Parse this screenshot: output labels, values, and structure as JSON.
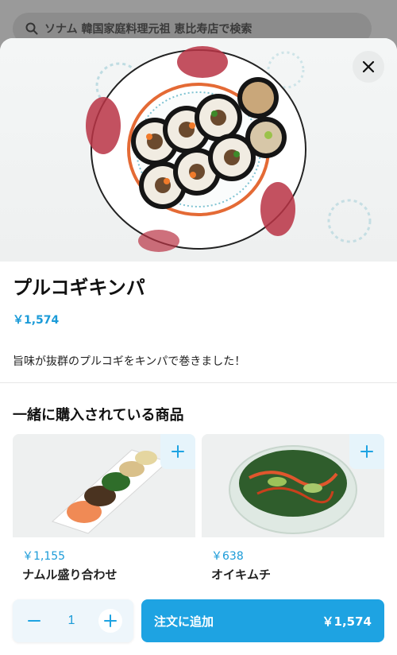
{
  "search": {
    "placeholder": "ソナム 韓国家庭料理元祖 恵比寿店で検索"
  },
  "product": {
    "name": "プルコギキンパ",
    "price": "￥1,574",
    "description": "旨味が抜群のプルコギをキンパで巻きました！"
  },
  "related": {
    "title": "一緒に購入されている商品",
    "items": [
      {
        "price": "￥1,155",
        "name": "ナムル盛り合わせ"
      },
      {
        "price": "￥638",
        "name": "オイキムチ"
      }
    ]
  },
  "order": {
    "quantity": "1",
    "add_label": "注文に追加",
    "total": "￥1,574"
  },
  "colors": {
    "accent": "#1ea3e2",
    "price_text": "#1b9bd8"
  }
}
